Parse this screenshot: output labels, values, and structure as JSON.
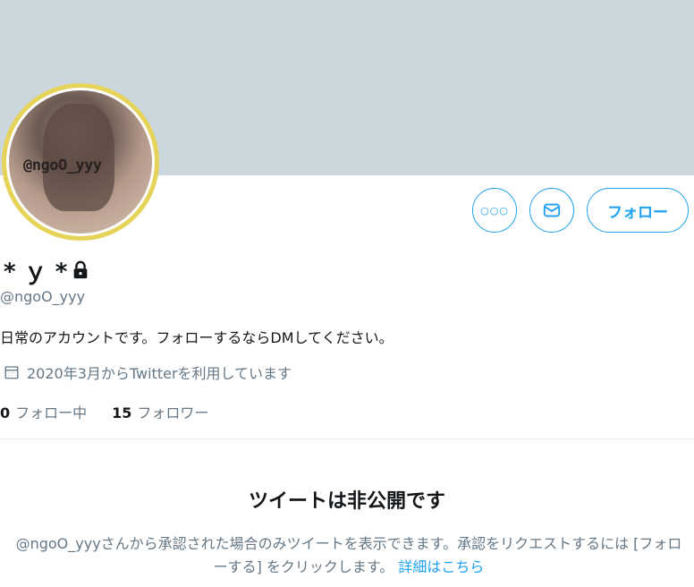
{
  "profile": {
    "avatar_tag": "@ngoO_yyy",
    "display_name": "* ｙ *",
    "handle": "@ngoO_yyy",
    "bio": "日常のアカウントです。フォローするならDMしてください。",
    "joined": "2020年3月からTwitterを利用しています",
    "following_count": "0",
    "following_label": "フォロー中",
    "followers_count": "15",
    "followers_label": "フォロワー"
  },
  "actions": {
    "more_icon": "more-icon",
    "dm_icon": "mail-icon",
    "follow_label": "フォロー"
  },
  "private_notice": {
    "title": "ツイートは非公開です",
    "description": "@ngoO_yyyさんから承認された場合のみツイートを表示できます。承認をリクエストするには [フォローする] をクリックします。",
    "link_label": "詳細はこちら"
  },
  "colors": {
    "accent": "#1da1f2",
    "banner": "#ccd6dd",
    "secondary_text": "#657786",
    "avatar_ring": "#e6d45a"
  }
}
